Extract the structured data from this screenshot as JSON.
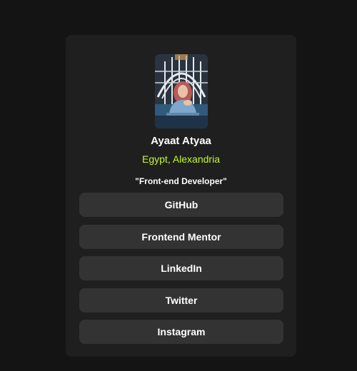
{
  "profile": {
    "name": "Ayaat Atyaa",
    "location": "Egypt, Alexandria",
    "bio": "\"Front-end Developer\""
  },
  "links": [
    {
      "label": "GitHub"
    },
    {
      "label": "Frontend Mentor"
    },
    {
      "label": "LinkedIn"
    },
    {
      "label": "Twitter"
    },
    {
      "label": "Instagram"
    }
  ],
  "colors": {
    "page_background": "#141414",
    "card_background": "#1f1f1f",
    "button_background": "#333333",
    "accent": "#c4f82a",
    "text": "#ffffff"
  }
}
